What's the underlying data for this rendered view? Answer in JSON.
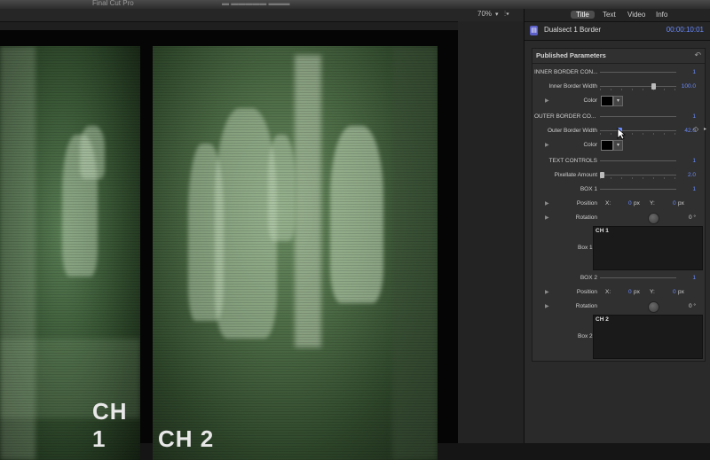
{
  "window": {
    "app_title": "Final Cut Pro",
    "center_title": "▬ ▬▬▬▬▬ ▬▬▬"
  },
  "viewer": {
    "zoom": "70%",
    "channels": [
      {
        "label": "CH 1"
      },
      {
        "label": "CH 2"
      }
    ]
  },
  "inspector": {
    "tabs": [
      {
        "label": "Title",
        "active": true
      },
      {
        "label": "Text",
        "active": false
      },
      {
        "label": "Video",
        "active": false
      },
      {
        "label": "Info",
        "active": false
      }
    ],
    "generator": {
      "name": "Dualsect 1 Border",
      "timecode": "00:00:10:01",
      "icon": "generator-icon"
    },
    "published_parameters": {
      "title": "Published Parameters",
      "inner_border_controls": {
        "label": "INNER BORDER CON...",
        "value": "1"
      },
      "inner_border_width": {
        "label": "Inner Border Width",
        "value": "100.0"
      },
      "inner_color": {
        "label": "Color",
        "swatch": "#000000"
      },
      "outer_border_controls": {
        "label": "OUTER BORDER CO...",
        "value": "1"
      },
      "outer_border_width": {
        "label": "Outer Border Width",
        "value": "42.0"
      },
      "outer_color": {
        "label": "Color",
        "swatch": "#000000"
      },
      "text_controls": {
        "label": "TEXT CONTROLS",
        "value": "1"
      },
      "pixellate_amount": {
        "label": "Pixellate Amount",
        "value": "2.0"
      },
      "box1": {
        "label": "BOX 1",
        "value": "1",
        "position": {
          "label": "Position",
          "x_label": "X:",
          "x": "0",
          "x_unit": "px",
          "y_label": "Y:",
          "y": "0",
          "y_unit": "px"
        },
        "rotation": {
          "label": "Rotation",
          "value": "0 °"
        },
        "text_label": "Box 1",
        "text": "CH 1"
      },
      "box2": {
        "label": "BOX 2",
        "value": "1",
        "position": {
          "label": "Position",
          "x_label": "X:",
          "x": "0",
          "x_unit": "px",
          "y_label": "Y:",
          "y": "0",
          "y_unit": "px"
        },
        "rotation": {
          "label": "Rotation",
          "value": "0 °"
        },
        "text_label": "Box 2",
        "text": "CH 2"
      }
    }
  },
  "colors": {
    "accent_blue": "#6b8cff",
    "generator_icon": "#5b5fc7",
    "night_vision_green": "#4c6b45"
  }
}
